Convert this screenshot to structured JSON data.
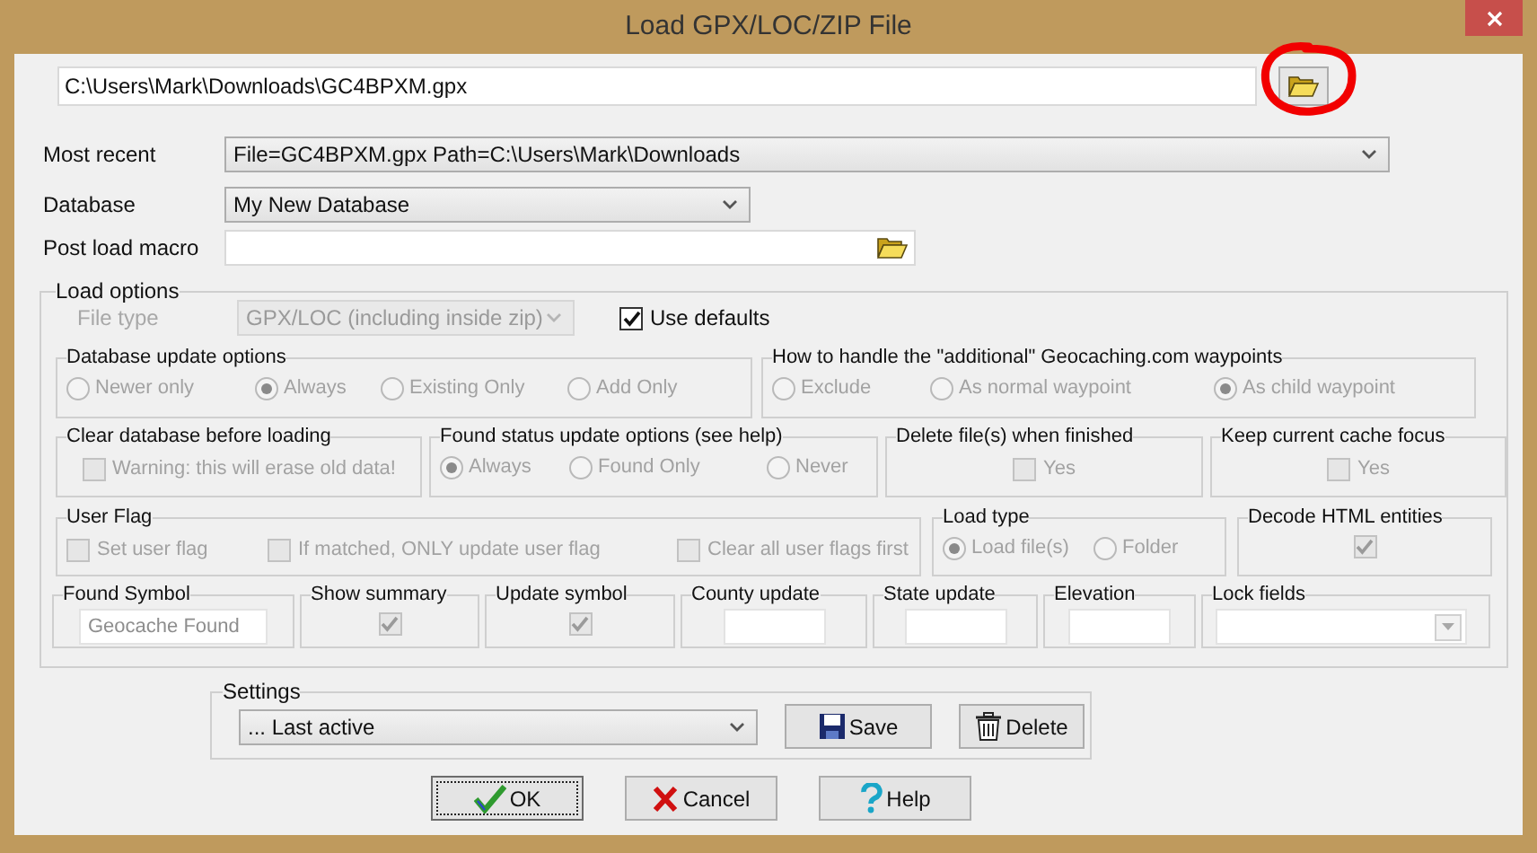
{
  "window": {
    "title": "Load GPX/LOC/ZIP File"
  },
  "file_path": {
    "value": "C:\\Users\\Mark\\Downloads\\GC4BPXM.gpx",
    "highlighted": true
  },
  "most_recent": {
    "label": "Most recent",
    "value": "File=GC4BPXM.gpx Path=C:\\Users\\Mark\\Downloads"
  },
  "database": {
    "label": "Database",
    "value": "My New Database"
  },
  "post_load_macro": {
    "label": "Post load macro"
  },
  "load_options": {
    "title": "Load options",
    "file_type": {
      "label": "File type",
      "value": "GPX/LOC (including inside zip)",
      "disabled": true
    },
    "use_defaults": {
      "label": "Use defaults",
      "checked": true
    },
    "lines": [
      {
        "groups": [
          {
            "title": "Database update options",
            "kind": "radio",
            "disabled": true,
            "options": [
              {
                "label": "Newer only",
                "selected": false
              },
              {
                "label": "Always",
                "selected": true
              },
              {
                "label": "Existing Only",
                "selected": false
              },
              {
                "label": "Add Only",
                "selected": false
              }
            ]
          },
          {
            "title": "How to handle the \"additional\" Geocaching.com waypoints",
            "kind": "radio",
            "disabled": true,
            "options": [
              {
                "label": "Exclude",
                "selected": false
              },
              {
                "label": "As normal waypoint",
                "selected": false
              },
              {
                "label": "As child waypoint",
                "selected": true
              }
            ]
          }
        ]
      },
      {
        "groups": [
          {
            "title": "Clear database before loading",
            "kind": "checkbox",
            "disabled": true,
            "options": [
              {
                "label": "Warning: this will erase old data!",
                "checked": false
              }
            ]
          },
          {
            "title": "Found status update options (see help)",
            "kind": "radio",
            "disabled": true,
            "options": [
              {
                "label": "Always",
                "selected": true
              },
              {
                "label": "Found Only",
                "selected": false
              },
              {
                "label": "Never",
                "selected": false
              }
            ]
          },
          {
            "title": "Delete file(s) when finished",
            "kind": "checkbox",
            "disabled": true,
            "options": [
              {
                "label": "Yes",
                "checked": false
              }
            ]
          },
          {
            "title": "Keep current cache focus",
            "kind": "checkbox",
            "disabled": true,
            "options": [
              {
                "label": "Yes",
                "checked": false
              }
            ]
          }
        ]
      },
      {
        "groups": [
          {
            "title": "User Flag",
            "kind": "checkbox",
            "disabled": true,
            "options": [
              {
                "label": "Set user flag",
                "checked": false
              },
              {
                "label": "If matched, ONLY update user flag",
                "checked": false
              },
              {
                "label": "Clear all user flags first",
                "checked": false
              }
            ]
          },
          {
            "title": "Load type",
            "kind": "radio",
            "disabled": true,
            "options": [
              {
                "label": "Load file(s)",
                "selected": true
              },
              {
                "label": "Folder",
                "selected": false
              }
            ]
          },
          {
            "title": "Decode HTML entities",
            "kind": "checkbox",
            "disabled": true,
            "options": [
              {
                "checked": true
              }
            ]
          }
        ]
      },
      {
        "groups": [
          {
            "title": "Found Symbol",
            "kind": "text",
            "disabled": true,
            "value": "Geocache Found"
          },
          {
            "title": "Show summary",
            "kind": "checkbox",
            "disabled": true,
            "options": [
              {
                "checked": true
              }
            ]
          },
          {
            "title": "Update symbol",
            "kind": "checkbox",
            "disabled": true,
            "options": [
              {
                "checked": true
              }
            ]
          },
          {
            "title": "County update",
            "kind": "text"
          },
          {
            "title": "State update",
            "kind": "text"
          },
          {
            "title": "Elevation",
            "kind": "text"
          },
          {
            "title": "Lock fields",
            "kind": "combo",
            "disabled": true
          }
        ]
      }
    ]
  },
  "settings": {
    "title": "Settings",
    "value": "... Last active",
    "buttons": [
      {
        "label": "Save",
        "kind": "save"
      },
      {
        "label": "Delete",
        "kind": "delete"
      }
    ]
  },
  "buttons": [
    {
      "label": "OK",
      "kind": "ok",
      "focused": true
    },
    {
      "label": "Cancel",
      "kind": "cancel",
      "focused": false
    },
    {
      "label": "Help",
      "kind": "help",
      "focused": false
    }
  ]
}
